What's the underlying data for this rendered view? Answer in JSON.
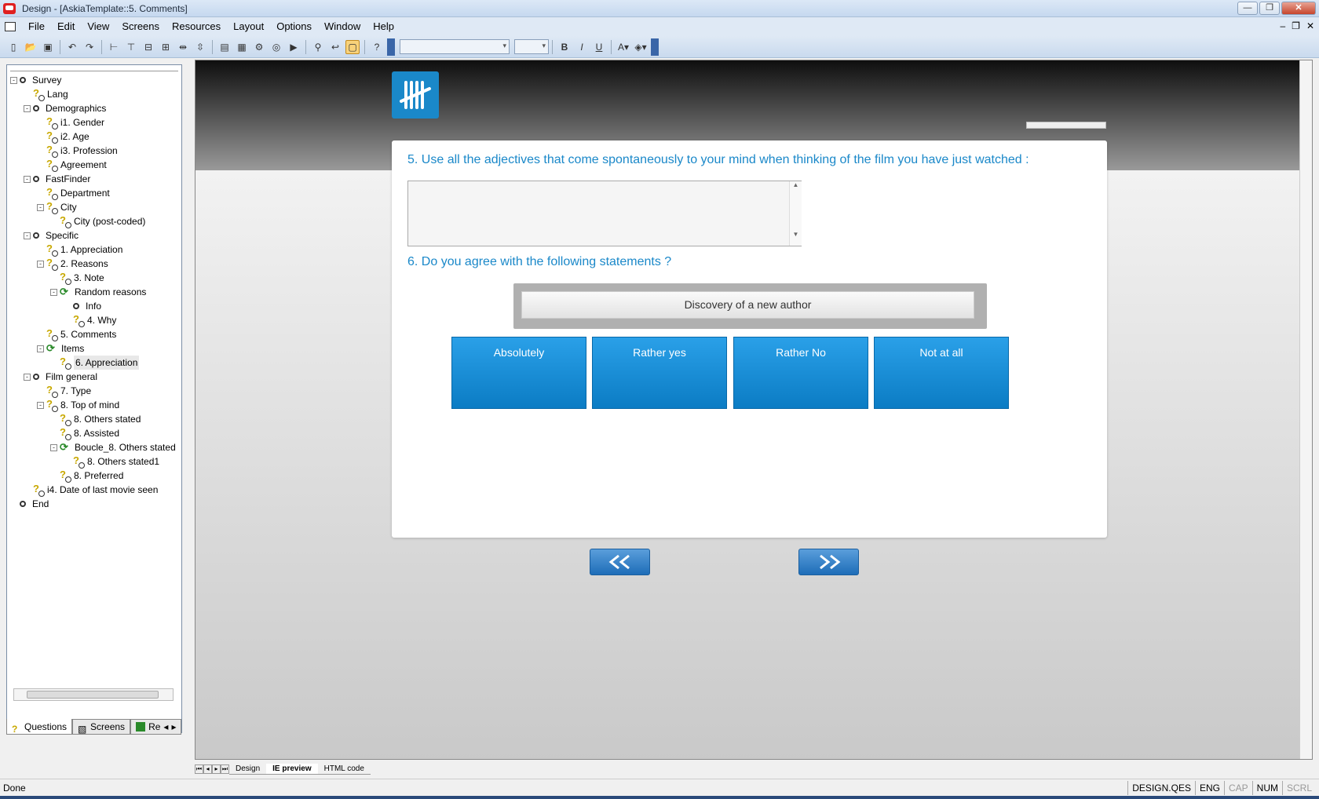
{
  "window": {
    "title": "Design - [AskiaTemplate::5. Comments]",
    "controls": [
      "minimize",
      "restore",
      "close"
    ]
  },
  "menu": {
    "items": [
      "File",
      "Edit",
      "View",
      "Screens",
      "Resources",
      "Layout",
      "Options",
      "Window",
      "Help"
    ]
  },
  "tree": {
    "items": [
      {
        "label": "Survey",
        "icon": "chapter-icon",
        "level": 0,
        "expander": "-"
      },
      {
        "label": "Lang",
        "icon": "question-icon",
        "level": 1,
        "expander": ""
      },
      {
        "label": "Demographics",
        "icon": "chapter-icon",
        "level": 1,
        "expander": "-"
      },
      {
        "label": "i1. Gender",
        "icon": "question-icon",
        "level": 2,
        "expander": ""
      },
      {
        "label": "i2. Age",
        "icon": "question-icon",
        "level": 2,
        "expander": ""
      },
      {
        "label": "i3. Profession",
        "icon": "question-icon",
        "level": 2,
        "expander": ""
      },
      {
        "label": "Agreement",
        "icon": "question-icon",
        "level": 2,
        "expander": ""
      },
      {
        "label": "FastFinder",
        "icon": "chapter-icon",
        "level": 1,
        "expander": "-"
      },
      {
        "label": "Department",
        "icon": "question-icon",
        "level": 2,
        "expander": ""
      },
      {
        "label": "City",
        "icon": "question-icon",
        "level": 2,
        "expander": "-"
      },
      {
        "label": "City (post-coded)",
        "icon": "question-icon",
        "level": 3,
        "expander": ""
      },
      {
        "label": "Specific",
        "icon": "chapter-icon",
        "level": 1,
        "expander": "-"
      },
      {
        "label": "1. Appreciation",
        "icon": "question-icon",
        "level": 2,
        "expander": ""
      },
      {
        "label": "2. Reasons",
        "icon": "question-icon",
        "level": 2,
        "expander": "-"
      },
      {
        "label": "3. Note",
        "icon": "question-icon",
        "level": 3,
        "expander": ""
      },
      {
        "label": "Random reasons",
        "icon": "loop-icon",
        "level": 3,
        "expander": "-"
      },
      {
        "label": "Info",
        "icon": "chapter-icon",
        "level": 4,
        "expander": ""
      },
      {
        "label": "4. Why",
        "icon": "question-icon",
        "level": 4,
        "expander": ""
      },
      {
        "label": "5. Comments",
        "icon": "question-icon",
        "level": 2,
        "expander": ""
      },
      {
        "label": "Items",
        "icon": "loop-icon",
        "level": 2,
        "expander": "-"
      },
      {
        "label": "6. Appreciation",
        "icon": "question-icon",
        "level": 3,
        "expander": "",
        "selected": true
      },
      {
        "label": "Film general",
        "icon": "chapter-icon",
        "level": 1,
        "expander": "-"
      },
      {
        "label": "7. Type",
        "icon": "question-icon",
        "level": 2,
        "expander": ""
      },
      {
        "label": "8. Top of mind",
        "icon": "question-icon",
        "level": 2,
        "expander": "-"
      },
      {
        "label": "8. Others stated",
        "icon": "question-icon",
        "level": 3,
        "expander": ""
      },
      {
        "label": "8. Assisted",
        "icon": "question-icon",
        "level": 3,
        "expander": ""
      },
      {
        "label": "Boucle_8. Others stated",
        "icon": "loop-icon",
        "level": 3,
        "expander": "-"
      },
      {
        "label": "8. Others stated1",
        "icon": "question-icon",
        "level": 4,
        "expander": ""
      },
      {
        "label": "8. Preferred",
        "icon": "question-icon",
        "level": 3,
        "expander": ""
      },
      {
        "label": "i4. Date of last movie seen",
        "icon": "question-icon",
        "level": 1,
        "expander": ""
      },
      {
        "label": "End",
        "icon": "chapter-icon",
        "level": 0,
        "expander": ""
      }
    ]
  },
  "left_tabs": [
    {
      "label": "Questions",
      "icon": "question-tab-icon",
      "active": true
    },
    {
      "label": "Screens",
      "icon": "screens-tab-icon",
      "active": false
    },
    {
      "label": "Re",
      "icon": "resources-tab-icon",
      "active": false
    }
  ],
  "preview": {
    "q5_title": "5. Use all the adjectives that come spontaneously to your mind when thinking of the film you have just watched :",
    "q5_value": "",
    "q6_title": "6. Do you agree with the following statements ?",
    "statement": "Discovery of a new author",
    "answers": [
      "Absolutely",
      "Rather yes",
      "Rather No",
      "Not at all"
    ],
    "prev_label": "<<",
    "next_label": ">>"
  },
  "sheet_tabs": [
    {
      "label": "Design",
      "active": false
    },
    {
      "label": "IE preview",
      "active": true
    },
    {
      "label": "HTML code",
      "active": false
    }
  ],
  "status": {
    "text": "Done",
    "panels": [
      "DESIGN.QES",
      "ENG",
      "CAP",
      "NUM",
      "SCRL"
    ],
    "dim_panels": [
      "CAP",
      "SCRL"
    ]
  },
  "colors": {
    "accent": "#1a88c9",
    "answer_button": "#0b7cc4",
    "nav_button": "#2a78c0"
  }
}
